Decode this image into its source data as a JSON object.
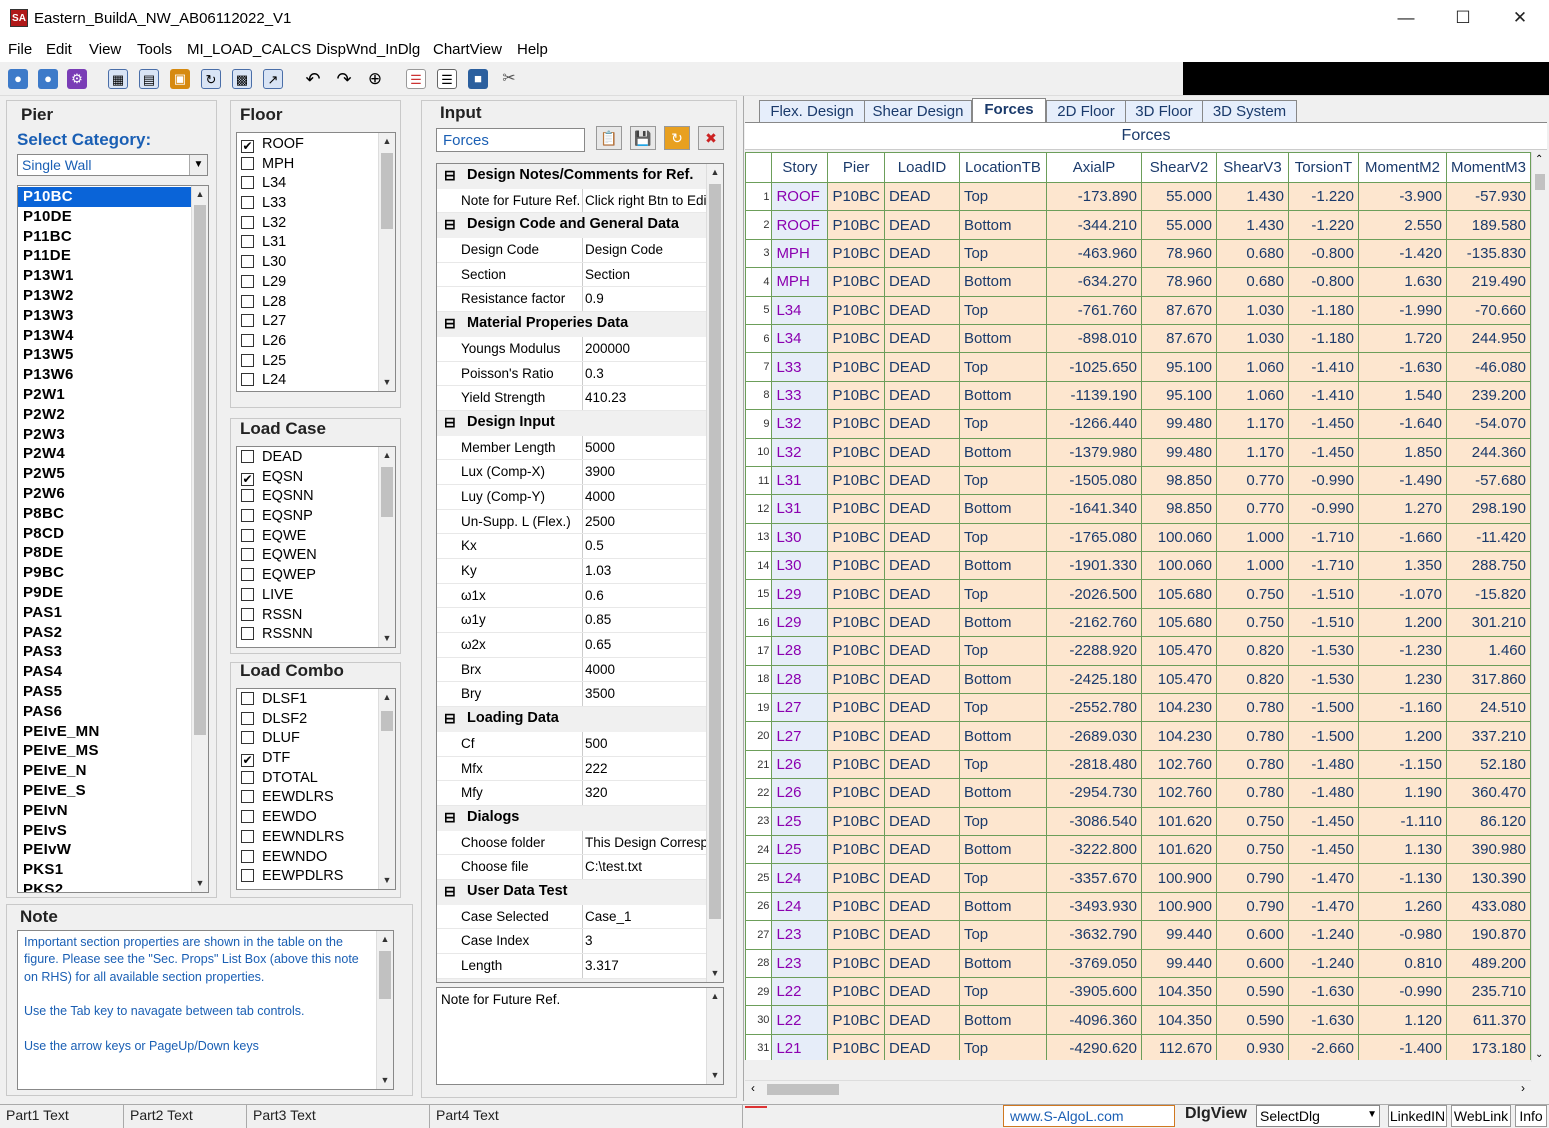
{
  "window": {
    "title": "Eastern_BuildA_NW_AB06112022_V1",
    "icon": "app-icon"
  },
  "menu": [
    "File",
    "Edit",
    "View",
    "Tools",
    "MI_LOAD_CALCS",
    "DispWnd_InDlg",
    "ChartView",
    "Help"
  ],
  "pier": {
    "header": "Pier",
    "category_label": "Select Category:",
    "category_value": "Single Wall",
    "items": [
      "P10BC",
      "P10DE",
      "P11BC",
      "P11DE",
      "P13W1",
      "P13W2",
      "P13W3",
      "P13W4",
      "P13W5",
      "P13W6",
      "P2W1",
      "P2W2",
      "P2W3",
      "P2W4",
      "P2W5",
      "P2W6",
      "P8BC",
      "P8CD",
      "P8DE",
      "P9BC",
      "P9DE",
      "PAS1",
      "PAS2",
      "PAS3",
      "PAS4",
      "PAS5",
      "PAS6",
      "PEIvE_MN",
      "PEIvE_MS",
      "PEIvE_N",
      "PEIvE_S",
      "PEIvN",
      "PEIvS",
      "PEIvW",
      "PKS1",
      "PKS2"
    ],
    "selected": "P10BC"
  },
  "floor": {
    "header": "Floor",
    "items": [
      {
        "label": "ROOF",
        "checked": true
      },
      {
        "label": "MPH",
        "checked": false
      },
      {
        "label": "L34",
        "checked": false
      },
      {
        "label": "L33",
        "checked": false
      },
      {
        "label": "L32",
        "checked": false
      },
      {
        "label": "L31",
        "checked": false
      },
      {
        "label": "L30",
        "checked": false
      },
      {
        "label": "L29",
        "checked": false
      },
      {
        "label": "L28",
        "checked": false
      },
      {
        "label": "L27",
        "checked": false
      },
      {
        "label": "L26",
        "checked": false
      },
      {
        "label": "L25",
        "checked": false
      },
      {
        "label": "L24",
        "checked": false
      }
    ]
  },
  "load_case": {
    "header": "Load Case",
    "items": [
      {
        "label": "DEAD",
        "checked": false
      },
      {
        "label": "EQSN",
        "checked": true
      },
      {
        "label": "EQSNN",
        "checked": false
      },
      {
        "label": "EQSNP",
        "checked": false
      },
      {
        "label": "EQWE",
        "checked": false
      },
      {
        "label": "EQWEN",
        "checked": false
      },
      {
        "label": "EQWEP",
        "checked": false
      },
      {
        "label": "LIVE",
        "checked": false
      },
      {
        "label": "RSSN",
        "checked": false
      },
      {
        "label": "RSSNN",
        "checked": false
      }
    ]
  },
  "load_combo": {
    "header": "Load Combo",
    "items": [
      {
        "label": "DLSF1",
        "checked": false
      },
      {
        "label": "DLSF2",
        "checked": false
      },
      {
        "label": "DLUF",
        "checked": false
      },
      {
        "label": "DTF",
        "checked": true
      },
      {
        "label": "DTOTAL",
        "checked": false
      },
      {
        "label": "EEWDLRS",
        "checked": false
      },
      {
        "label": "EEWDO",
        "checked": false
      },
      {
        "label": "EEWNDLRS",
        "checked": false
      },
      {
        "label": "EEWNDO",
        "checked": false
      },
      {
        "label": "EEWPDLRS",
        "checked": false
      }
    ]
  },
  "note": {
    "header": "Note",
    "text": "Important section properties are shown in the table on the figure. Please see the \"Sec. Props\" List Box (above this note on RHS) for all available section properties.\n\nUse the Tab key to navagate between tab controls.\n\nUse the arrow keys or PageUp/Down keys"
  },
  "input": {
    "header": "Input",
    "combo_value": "Forces",
    "grid": [
      {
        "type": "cat",
        "label": "Design Notes/Comments for Ref."
      },
      {
        "type": "prop",
        "name": "Note for Future Ref.",
        "value": "Click right Btn to Edit"
      },
      {
        "type": "cat",
        "label": "Design Code and General Data"
      },
      {
        "type": "prop",
        "name": "Design Code",
        "value": "Design Code"
      },
      {
        "type": "prop",
        "name": "Section",
        "value": "Section"
      },
      {
        "type": "prop",
        "name": "Resistance factor",
        "value": "0.9"
      },
      {
        "type": "cat",
        "label": "Material Properies Data"
      },
      {
        "type": "prop",
        "name": "Youngs Modulus",
        "value": "200000"
      },
      {
        "type": "prop",
        "name": "Poisson's Ratio",
        "value": "0.3"
      },
      {
        "type": "prop",
        "name": "Yield Strength",
        "value": "410.23"
      },
      {
        "type": "cat",
        "label": "Design Input"
      },
      {
        "type": "prop",
        "name": "Member Length",
        "value": "5000"
      },
      {
        "type": "prop",
        "name": "Lux (Comp-X)",
        "value": "3900"
      },
      {
        "type": "prop",
        "name": "Luy (Comp-Y)",
        "value": "4000"
      },
      {
        "type": "prop",
        "name": "Un-Supp. L (Flex.)",
        "value": "2500"
      },
      {
        "type": "prop",
        "name": "Kx",
        "value": "0.5"
      },
      {
        "type": "prop",
        "name": "Ky",
        "value": "1.03"
      },
      {
        "type": "prop",
        "name": "ω1x",
        "value": "0.6"
      },
      {
        "type": "prop",
        "name": "ω1y",
        "value": "0.85"
      },
      {
        "type": "prop",
        "name": "ω2x",
        "value": "0.65"
      },
      {
        "type": "prop",
        "name": "Brx",
        "value": "4000"
      },
      {
        "type": "prop",
        "name": "Bry",
        "value": "3500"
      },
      {
        "type": "cat",
        "label": "Loading Data"
      },
      {
        "type": "prop",
        "name": "Cf",
        "value": "500"
      },
      {
        "type": "prop",
        "name": "Mfx",
        "value": "222"
      },
      {
        "type": "prop",
        "name": "Mfy",
        "value": "320"
      },
      {
        "type": "cat",
        "label": "Dialogs"
      },
      {
        "type": "prop",
        "name": "Choose folder",
        "value": "This Design Corresp"
      },
      {
        "type": "prop",
        "name": "Choose file",
        "value": "C:\\test.txt"
      },
      {
        "type": "cat",
        "label": "User Data Test"
      },
      {
        "type": "prop",
        "name": "Case Selected",
        "value": "Case_1"
      },
      {
        "type": "prop",
        "name": "Case Index",
        "value": "3"
      },
      {
        "type": "prop",
        "name": "Length",
        "value": "3.317"
      }
    ],
    "description": "Note for Future Ref."
  },
  "tabs": [
    {
      "label": "Flex. Design"
    },
    {
      "label": "Shear Design"
    },
    {
      "label": "Forces",
      "active": true
    },
    {
      "label": "2D Floor"
    },
    {
      "label": "3D Floor"
    },
    {
      "label": "3D System"
    }
  ],
  "forces": {
    "caption": "Forces",
    "columns": [
      "Story",
      "Pier",
      "LoadID",
      "LocationTB",
      "AxialP",
      "ShearV2",
      "ShearV3",
      "TorsionT",
      "MomentM2",
      "MomentM3"
    ],
    "rows": [
      [
        "1",
        "ROOF",
        "P10BC",
        "DEAD",
        "Top",
        "-173.890",
        "55.000",
        "1.430",
        "-1.220",
        "-3.900",
        "-57.930"
      ],
      [
        "2",
        "ROOF",
        "P10BC",
        "DEAD",
        "Bottom",
        "-344.210",
        "55.000",
        "1.430",
        "-1.220",
        "2.550",
        "189.580"
      ],
      [
        "3",
        "MPH",
        "P10BC",
        "DEAD",
        "Top",
        "-463.960",
        "78.960",
        "0.680",
        "-0.800",
        "-1.420",
        "-135.830"
      ],
      [
        "4",
        "MPH",
        "P10BC",
        "DEAD",
        "Bottom",
        "-634.270",
        "78.960",
        "0.680",
        "-0.800",
        "1.630",
        "219.490"
      ],
      [
        "5",
        "L34",
        "P10BC",
        "DEAD",
        "Top",
        "-761.760",
        "87.670",
        "1.030",
        "-1.180",
        "-1.990",
        "-70.660"
      ],
      [
        "6",
        "L34",
        "P10BC",
        "DEAD",
        "Bottom",
        "-898.010",
        "87.670",
        "1.030",
        "-1.180",
        "1.720",
        "244.950"
      ],
      [
        "7",
        "L33",
        "P10BC",
        "DEAD",
        "Top",
        "-1025.650",
        "95.100",
        "1.060",
        "-1.410",
        "-1.630",
        "-46.080"
      ],
      [
        "8",
        "L33",
        "P10BC",
        "DEAD",
        "Bottom",
        "-1139.190",
        "95.100",
        "1.060",
        "-1.410",
        "1.540",
        "239.200"
      ],
      [
        "9",
        "L32",
        "P10BC",
        "DEAD",
        "Top",
        "-1266.440",
        "99.480",
        "1.170",
        "-1.450",
        "-1.640",
        "-54.070"
      ],
      [
        "10",
        "L32",
        "P10BC",
        "DEAD",
        "Bottom",
        "-1379.980",
        "99.480",
        "1.170",
        "-1.450",
        "1.850",
        "244.360"
      ],
      [
        "11",
        "L31",
        "P10BC",
        "DEAD",
        "Top",
        "-1505.080",
        "98.850",
        "0.770",
        "-0.990",
        "-1.490",
        "-57.680"
      ],
      [
        "12",
        "L31",
        "P10BC",
        "DEAD",
        "Bottom",
        "-1641.340",
        "98.850",
        "0.770",
        "-0.990",
        "1.270",
        "298.190"
      ],
      [
        "13",
        "L30",
        "P10BC",
        "DEAD",
        "Top",
        "-1765.080",
        "100.060",
        "1.000",
        "-1.710",
        "-1.660",
        "-11.420"
      ],
      [
        "14",
        "L30",
        "P10BC",
        "DEAD",
        "Bottom",
        "-1901.330",
        "100.060",
        "1.000",
        "-1.710",
        "1.350",
        "288.750"
      ],
      [
        "15",
        "L29",
        "P10BC",
        "DEAD",
        "Top",
        "-2026.500",
        "105.680",
        "0.750",
        "-1.510",
        "-1.070",
        "-15.820"
      ],
      [
        "16",
        "L29",
        "P10BC",
        "DEAD",
        "Bottom",
        "-2162.760",
        "105.680",
        "0.750",
        "-1.510",
        "1.200",
        "301.210"
      ],
      [
        "17",
        "L28",
        "P10BC",
        "DEAD",
        "Top",
        "-2288.920",
        "105.470",
        "0.820",
        "-1.530",
        "-1.230",
        "1.460"
      ],
      [
        "18",
        "L28",
        "P10BC",
        "DEAD",
        "Bottom",
        "-2425.180",
        "105.470",
        "0.820",
        "-1.530",
        "1.230",
        "317.860"
      ],
      [
        "19",
        "L27",
        "P10BC",
        "DEAD",
        "Top",
        "-2552.780",
        "104.230",
        "0.780",
        "-1.500",
        "-1.160",
        "24.510"
      ],
      [
        "20",
        "L27",
        "P10BC",
        "DEAD",
        "Bottom",
        "-2689.030",
        "104.230",
        "0.780",
        "-1.500",
        "1.200",
        "337.210"
      ],
      [
        "21",
        "L26",
        "P10BC",
        "DEAD",
        "Top",
        "-2818.480",
        "102.760",
        "0.780",
        "-1.480",
        "-1.150",
        "52.180"
      ],
      [
        "22",
        "L26",
        "P10BC",
        "DEAD",
        "Bottom",
        "-2954.730",
        "102.760",
        "0.780",
        "-1.480",
        "1.190",
        "360.470"
      ],
      [
        "23",
        "L25",
        "P10BC",
        "DEAD",
        "Top",
        "-3086.540",
        "101.620",
        "0.750",
        "-1.450",
        "-1.110",
        "86.120"
      ],
      [
        "24",
        "L25",
        "P10BC",
        "DEAD",
        "Bottom",
        "-3222.800",
        "101.620",
        "0.750",
        "-1.450",
        "1.130",
        "390.980"
      ],
      [
        "25",
        "L24",
        "P10BC",
        "DEAD",
        "Top",
        "-3357.670",
        "100.900",
        "0.790",
        "-1.470",
        "-1.130",
        "130.390"
      ],
      [
        "26",
        "L24",
        "P10BC",
        "DEAD",
        "Bottom",
        "-3493.930",
        "100.900",
        "0.790",
        "-1.470",
        "1.260",
        "433.080"
      ],
      [
        "27",
        "L23",
        "P10BC",
        "DEAD",
        "Top",
        "-3632.790",
        "99.440",
        "0.600",
        "-1.240",
        "-0.980",
        "190.870"
      ],
      [
        "28",
        "L23",
        "P10BC",
        "DEAD",
        "Bottom",
        "-3769.050",
        "99.440",
        "0.600",
        "-1.240",
        "0.810",
        "489.200"
      ],
      [
        "29",
        "L22",
        "P10BC",
        "DEAD",
        "Top",
        "-3905.600",
        "104.350",
        "0.590",
        "-1.630",
        "-0.990",
        "235.710"
      ],
      [
        "30",
        "L22",
        "P10BC",
        "DEAD",
        "Bottom",
        "-4096.360",
        "104.350",
        "0.590",
        "-1.630",
        "1.120",
        "611.370"
      ],
      [
        "31",
        "L21",
        "P10BC",
        "DEAD",
        "Top",
        "-4290.620",
        "112.670",
        "0.930",
        "-2.660",
        "-1.400",
        "173.180"
      ]
    ]
  },
  "status": {
    "part1": "Part1 Text",
    "part2": "Part2 Text",
    "part3": "Part3 Text",
    "part4": "Part4 Text",
    "url": "www.S-AlgoL.com",
    "dlgview_label": "DlgView",
    "dlgview_value": "SelectDlg",
    "linkedin": "LinkedIN",
    "weblink": "WebLink",
    "info": "Info"
  }
}
